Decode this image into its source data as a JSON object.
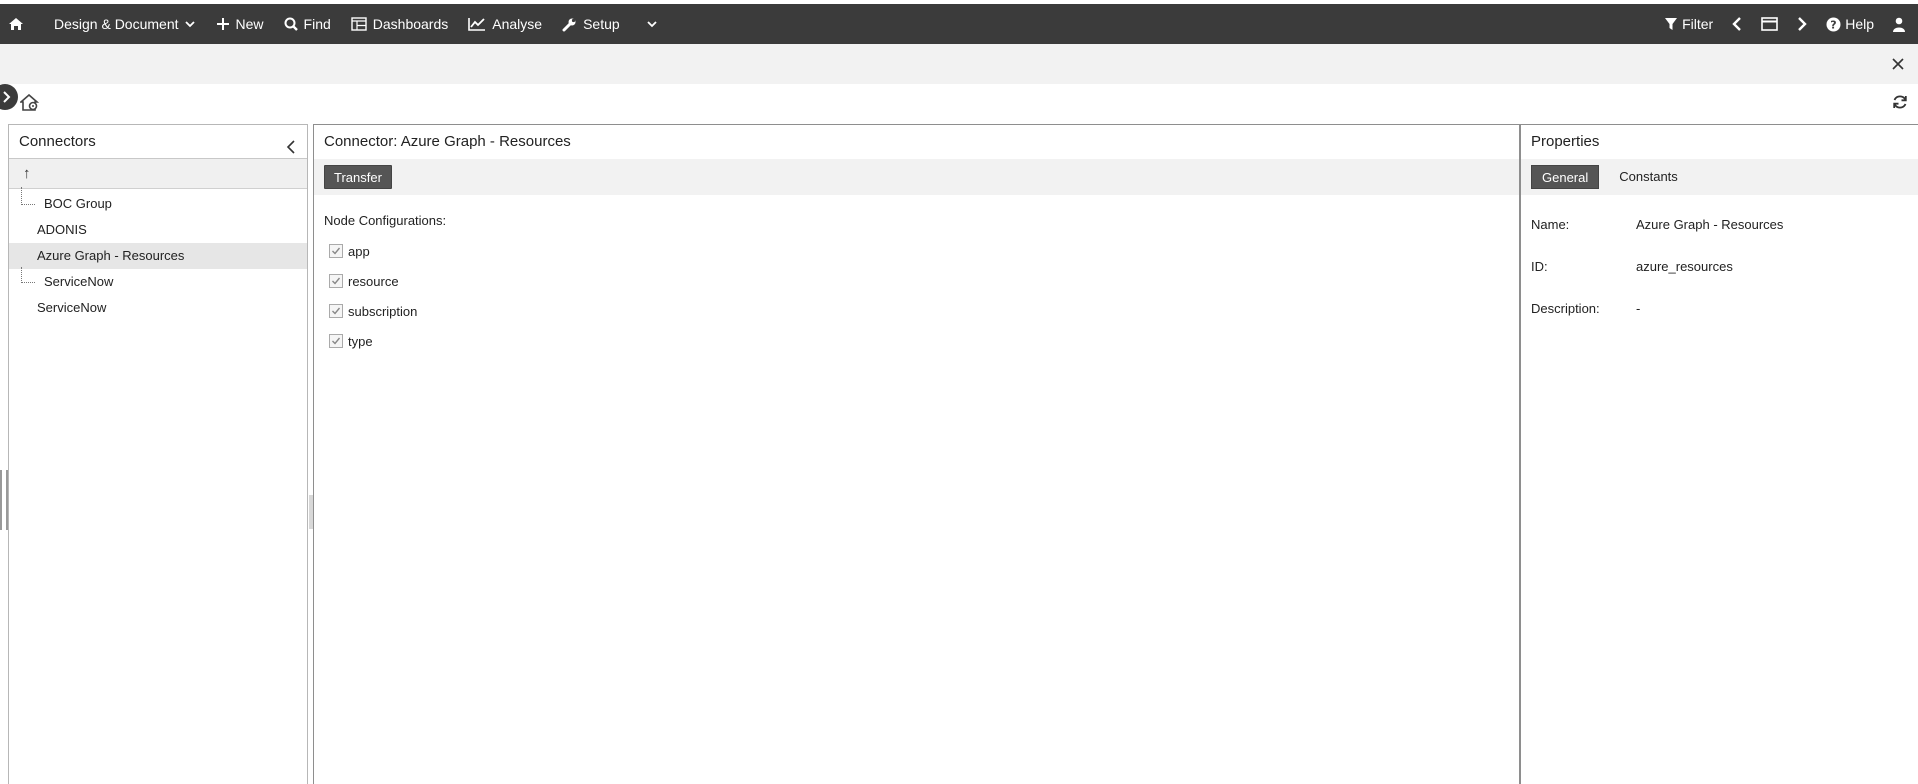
{
  "topbar": {
    "menu_design": "Design & Document",
    "menu_new": "New",
    "menu_find": "Find",
    "menu_dashboards": "Dashboards",
    "menu_analyse": "Analyse",
    "menu_setup": "Setup",
    "filter": "Filter",
    "help": "Help"
  },
  "connectors": {
    "title": "Connectors",
    "up_label": "↑",
    "items": [
      {
        "label": "BOC Group",
        "level": 0
      },
      {
        "label": "ADONIS",
        "level": 1
      },
      {
        "label": "Azure Graph - Resources",
        "level": 1,
        "selected": true
      },
      {
        "label": "ServiceNow",
        "level": 0
      },
      {
        "label": "ServiceNow",
        "level": 1
      }
    ]
  },
  "main": {
    "title": "Connector: Azure Graph - Resources",
    "transfer_button": "Transfer",
    "node_config_label": "Node Configurations:",
    "nodes": [
      {
        "label": "app",
        "checked": true
      },
      {
        "label": "resource",
        "checked": true
      },
      {
        "label": "subscription",
        "checked": true
      },
      {
        "label": "type",
        "checked": true
      }
    ]
  },
  "properties": {
    "title": "Properties",
    "tabs": [
      "General",
      "Constants"
    ],
    "active_tab": "General",
    "rows": [
      {
        "key": "Name:",
        "value": "Azure Graph - Resources"
      },
      {
        "key": "ID:",
        "value": "azure_resources"
      },
      {
        "key": "Description:",
        "value": "-"
      }
    ]
  },
  "colors": {
    "topbar_bg": "#3b3b3b",
    "button_dark": "#555555",
    "selected_row": "#e6e6e6"
  }
}
